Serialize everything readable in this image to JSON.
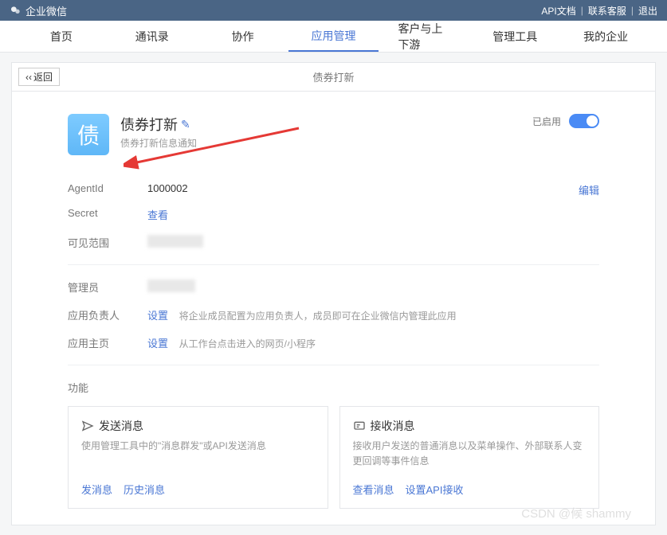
{
  "header": {
    "brand": "企业微信",
    "links": {
      "api_doc": "API文档",
      "contact": "联系客服",
      "logout": "退出"
    }
  },
  "nav": {
    "items": [
      "首页",
      "通讯录",
      "协作",
      "应用管理",
      "客户与上下游",
      "管理工具",
      "我的企业"
    ],
    "active_index": 3
  },
  "page": {
    "back": "返回",
    "title": "债券打新"
  },
  "app": {
    "icon_char": "债",
    "title": "债券打新",
    "subtitle": "债券打新信息通知",
    "enabled_label": "已启用"
  },
  "info": {
    "agent_id_label": "AgentId",
    "agent_id_value": "1000002",
    "secret_label": "Secret",
    "secret_action": "查看",
    "visible_label": "可见范围",
    "edit_label": "编辑",
    "admin_label": "管理员",
    "owner_label": "应用负责人",
    "owner_action": "设置",
    "owner_desc": "将企业成员配置为应用负责人，成员即可在企业微信内管理此应用",
    "home_label": "应用主页",
    "home_action": "设置",
    "home_desc": "从工作台点击进入的网页/小程序"
  },
  "functions": {
    "section_title": "功能",
    "send": {
      "title": "发送消息",
      "desc": "使用管理工具中的\"消息群发\"或API发送消息",
      "action1": "发消息",
      "action2": "历史消息"
    },
    "receive": {
      "title": "接收消息",
      "desc": "接收用户发送的普通消息以及菜单操作、外部联系人变更回调等事件信息",
      "action1": "查看消息",
      "action2": "设置API接收"
    }
  },
  "watermark": "CSDN @候 shammy"
}
